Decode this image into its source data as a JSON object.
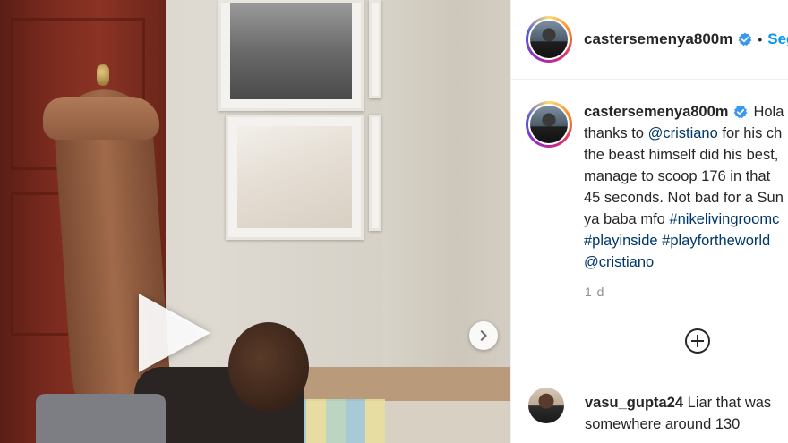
{
  "post": {
    "username": "castersemenya800m",
    "follow_label": "Segu",
    "dot": "•",
    "caption_lines": [
      "Hola f",
      "thanks to @cristiano for his ch",
      "the beast himself did his best,",
      "manage to scoop 176 in that",
      "45 seconds. Not bad for a Sun",
      "ya baba mfo #nikelivingroomc",
      "#playinside #playfortheworld",
      "@cristiano"
    ],
    "time": "1 d"
  },
  "comment": {
    "username": "vasu_gupta24",
    "text_line1": "Liar that was",
    "text_line2": "somewhere around 130"
  },
  "icons": {
    "verified": "verified-badge-icon",
    "next": "chevron-right-icon",
    "play": "play-icon",
    "add": "add-circle-icon"
  },
  "colors": {
    "link": "#0095f6",
    "verified": "#3897f0",
    "hashtag": "#00376b",
    "muted": "#8e8e8e"
  }
}
